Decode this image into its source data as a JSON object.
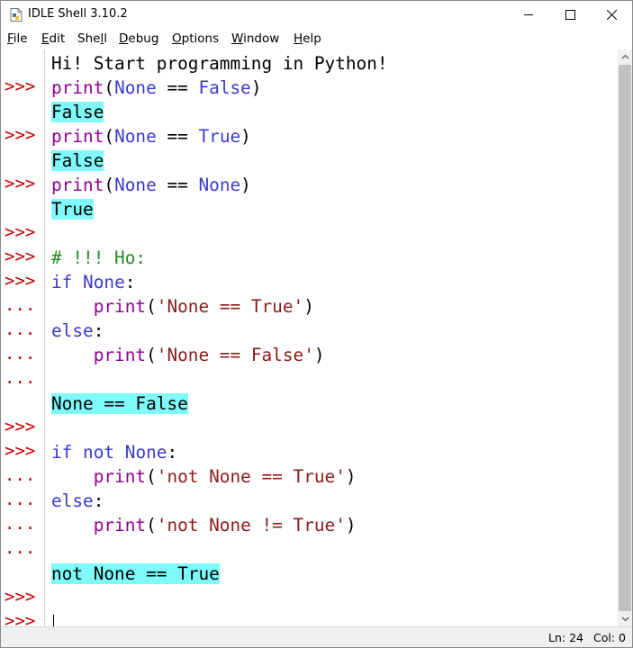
{
  "window": {
    "title": "IDLE Shell 3.10.2",
    "controls": {
      "minimize": "—",
      "maximize": "☐",
      "close": "✕"
    }
  },
  "menu": [
    {
      "label": "File",
      "hotkey": "F",
      "rest": "ile"
    },
    {
      "label": "Edit",
      "hotkey": "E",
      "rest": "dit"
    },
    {
      "label": "Shell",
      "pre": "She",
      "hotkey": "l",
      "rest": "l"
    },
    {
      "label": "Debug",
      "hotkey": "D",
      "rest": "ebug"
    },
    {
      "label": "Options",
      "hotkey": "O",
      "rest": "ptions"
    },
    {
      "label": "Window",
      "hotkey": "W",
      "rest": "indow"
    },
    {
      "label": "Help",
      "hotkey": "H",
      "rest": "elp"
    }
  ],
  "prompts": {
    "primary": ">>>",
    "continuation": "..."
  },
  "shell_lines": [
    {
      "prompt": "",
      "tokens": [
        {
          "t": "Hi! Start programming in Python!",
          "c": "plain"
        }
      ]
    },
    {
      "prompt": ">>>",
      "tokens": [
        {
          "t": "print",
          "c": "builtin"
        },
        {
          "t": "(",
          "c": "plain"
        },
        {
          "t": "None",
          "c": "kwblue"
        },
        {
          "t": " == ",
          "c": "plain"
        },
        {
          "t": "False",
          "c": "kwblue"
        },
        {
          "t": ")",
          "c": "plain"
        }
      ]
    },
    {
      "prompt": "",
      "tokens": [
        {
          "t": "False",
          "c": "out"
        }
      ]
    },
    {
      "prompt": ">>>",
      "tokens": [
        {
          "t": "print",
          "c": "builtin"
        },
        {
          "t": "(",
          "c": "plain"
        },
        {
          "t": "None",
          "c": "kwblue"
        },
        {
          "t": " == ",
          "c": "plain"
        },
        {
          "t": "True",
          "c": "kwblue"
        },
        {
          "t": ")",
          "c": "plain"
        }
      ]
    },
    {
      "prompt": "",
      "tokens": [
        {
          "t": "False",
          "c": "out"
        }
      ]
    },
    {
      "prompt": ">>>",
      "tokens": [
        {
          "t": "print",
          "c": "builtin"
        },
        {
          "t": "(",
          "c": "plain"
        },
        {
          "t": "None",
          "c": "kwblue"
        },
        {
          "t": " == ",
          "c": "plain"
        },
        {
          "t": "None",
          "c": "kwblue"
        },
        {
          "t": ")",
          "c": "plain"
        }
      ]
    },
    {
      "prompt": "",
      "tokens": [
        {
          "t": "True",
          "c": "out"
        }
      ]
    },
    {
      "prompt": ">>>",
      "tokens": []
    },
    {
      "prompt": ">>>",
      "tokens": [
        {
          "t": "# !!! Ho:",
          "c": "comment"
        }
      ]
    },
    {
      "prompt": ">>>",
      "tokens": [
        {
          "t": "if",
          "c": "kwblue"
        },
        {
          "t": " ",
          "c": "plain"
        },
        {
          "t": "None",
          "c": "kwblue"
        },
        {
          "t": ":",
          "c": "plain"
        }
      ]
    },
    {
      "prompt": "...",
      "tokens": [
        {
          "t": "    ",
          "c": "plain"
        },
        {
          "t": "print",
          "c": "builtin"
        },
        {
          "t": "(",
          "c": "plain"
        },
        {
          "t": "'None == True'",
          "c": "str"
        },
        {
          "t": ")",
          "c": "plain"
        }
      ]
    },
    {
      "prompt": "...",
      "tokens": [
        {
          "t": "else",
          "c": "kwblue"
        },
        {
          "t": ":",
          "c": "plain"
        }
      ]
    },
    {
      "prompt": "...",
      "tokens": [
        {
          "t": "    ",
          "c": "plain"
        },
        {
          "t": "print",
          "c": "builtin"
        },
        {
          "t": "(",
          "c": "plain"
        },
        {
          "t": "'None == False'",
          "c": "str"
        },
        {
          "t": ")",
          "c": "plain"
        }
      ]
    },
    {
      "prompt": "...",
      "tokens": []
    },
    {
      "prompt": "",
      "tokens": [
        {
          "t": "None == False",
          "c": "out"
        }
      ]
    },
    {
      "prompt": ">>>",
      "tokens": []
    },
    {
      "prompt": ">>>",
      "tokens": [
        {
          "t": "if",
          "c": "kwblue"
        },
        {
          "t": " ",
          "c": "plain"
        },
        {
          "t": "not",
          "c": "kwblue"
        },
        {
          "t": " ",
          "c": "plain"
        },
        {
          "t": "None",
          "c": "kwblue"
        },
        {
          "t": ":",
          "c": "plain"
        }
      ]
    },
    {
      "prompt": "...",
      "tokens": [
        {
          "t": "    ",
          "c": "plain"
        },
        {
          "t": "print",
          "c": "builtin"
        },
        {
          "t": "(",
          "c": "plain"
        },
        {
          "t": "'not None == True'",
          "c": "str"
        },
        {
          "t": ")",
          "c": "plain"
        }
      ]
    },
    {
      "prompt": "...",
      "tokens": [
        {
          "t": "else",
          "c": "kwblue"
        },
        {
          "t": ":",
          "c": "plain"
        }
      ]
    },
    {
      "prompt": "...",
      "tokens": [
        {
          "t": "    ",
          "c": "plain"
        },
        {
          "t": "print",
          "c": "builtin"
        },
        {
          "t": "(",
          "c": "plain"
        },
        {
          "t": "'not None != True'",
          "c": "str"
        },
        {
          "t": ")",
          "c": "plain"
        }
      ]
    },
    {
      "prompt": "...",
      "tokens": []
    },
    {
      "prompt": "",
      "tokens": [
        {
          "t": "not None == True",
          "c": "out"
        }
      ]
    },
    {
      "prompt": ">>>",
      "tokens": []
    },
    {
      "prompt": ">>>",
      "tokens": [],
      "caret": true
    }
  ],
  "status": {
    "line": "Ln: 24",
    "col": "Col: 0"
  },
  "colors": {
    "prompt": "#c00000",
    "builtin": "#900090",
    "keyword": "#3a3acc",
    "string": "#8b1a1a",
    "comment": "#228b22",
    "output_bg": "#7ffafa"
  },
  "icons": {
    "app": "idle-file-icon",
    "scroll_up": "chevron-up-icon",
    "scroll_down": "chevron-down-icon"
  }
}
